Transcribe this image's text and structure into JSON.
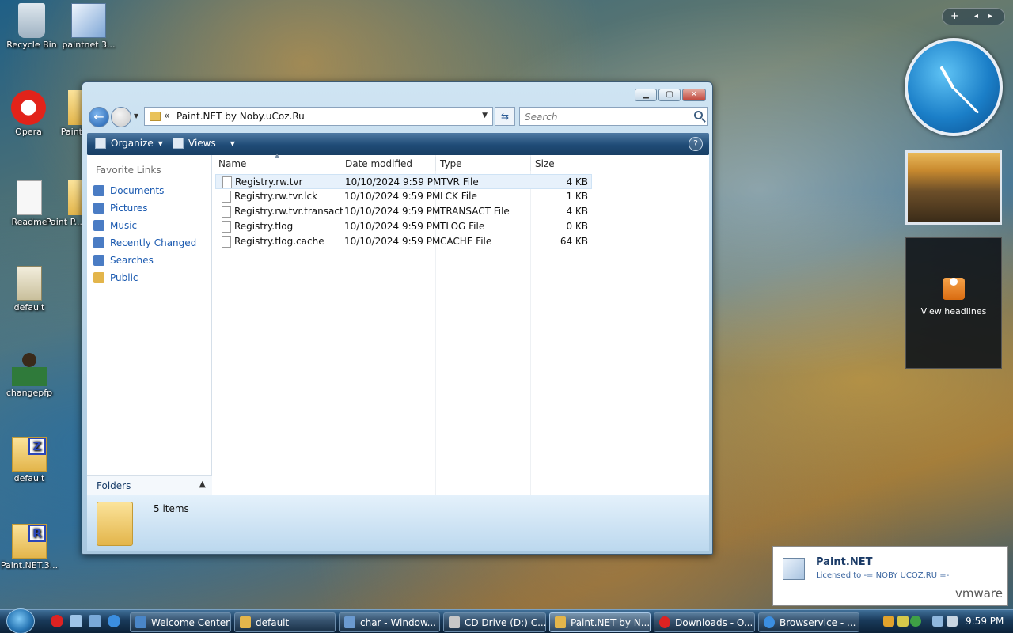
{
  "desktop": {
    "icons": [
      {
        "label": "Recycle Bin"
      },
      {
        "label": "paintnet 3..."
      },
      {
        "label": "Opera"
      },
      {
        "label": "Paint"
      },
      {
        "label": "Readme"
      },
      {
        "label": "Paint P..."
      },
      {
        "label": "default"
      },
      {
        "label": "changepfp"
      },
      {
        "label": "default"
      },
      {
        "label": "Paint.NET.3..."
      }
    ]
  },
  "sidebar": {
    "feed_label": "View headlines"
  },
  "window": {
    "address_path": "Paint.NET by Noby.uCoz.Ru",
    "search_placeholder": "Search",
    "toolbar": {
      "organize": "Organize",
      "views": "Views"
    },
    "favorites_title": "Favorite Links",
    "favorites": [
      {
        "label": "Documents",
        "color": "#4a7cc4"
      },
      {
        "label": "Pictures",
        "color": "#4a7cc4"
      },
      {
        "label": "Music",
        "color": "#4a7cc4"
      },
      {
        "label": "Recently Changed",
        "color": "#4a7cc4"
      },
      {
        "label": "Searches",
        "color": "#4a7cc4"
      },
      {
        "label": "Public",
        "color": "#e3b54b"
      }
    ],
    "folders_label": "Folders",
    "columns": {
      "name": "Name",
      "date": "Date modified",
      "type": "Type",
      "size": "Size"
    },
    "files": [
      {
        "name": "Registry.rw.tvr",
        "date": "10/10/2024 9:59 PM",
        "type": "TVR File",
        "size": "4 KB"
      },
      {
        "name": "Registry.rw.tvr.lck",
        "date": "10/10/2024 9:59 PM",
        "type": "LCK File",
        "size": "1 KB"
      },
      {
        "name": "Registry.rw.tvr.transact",
        "date": "10/10/2024 9:59 PM",
        "type": "TRANSACT File",
        "size": "4 KB"
      },
      {
        "name": "Registry.tlog",
        "date": "10/10/2024 9:59 PM",
        "type": "TLOG File",
        "size": "0 KB"
      },
      {
        "name": "Registry.tlog.cache",
        "date": "10/10/2024 9:59 PM",
        "type": "CACHE File",
        "size": "64 KB"
      }
    ],
    "item_count": "5 items"
  },
  "notification": {
    "title": "Paint.NET",
    "text": "Licensed to -= NOBY UCOZ.RU =-",
    "brand": "vmware"
  },
  "taskbar": {
    "buttons": [
      {
        "label": "Welcome Center"
      },
      {
        "label": "default"
      },
      {
        "label": "char - Window..."
      },
      {
        "label": "CD Drive (D:) C..."
      },
      {
        "label": "Paint.NET by N..."
      },
      {
        "label": "Downloads - O..."
      },
      {
        "label": "Browservice - ..."
      }
    ],
    "time": "9:59 PM"
  }
}
